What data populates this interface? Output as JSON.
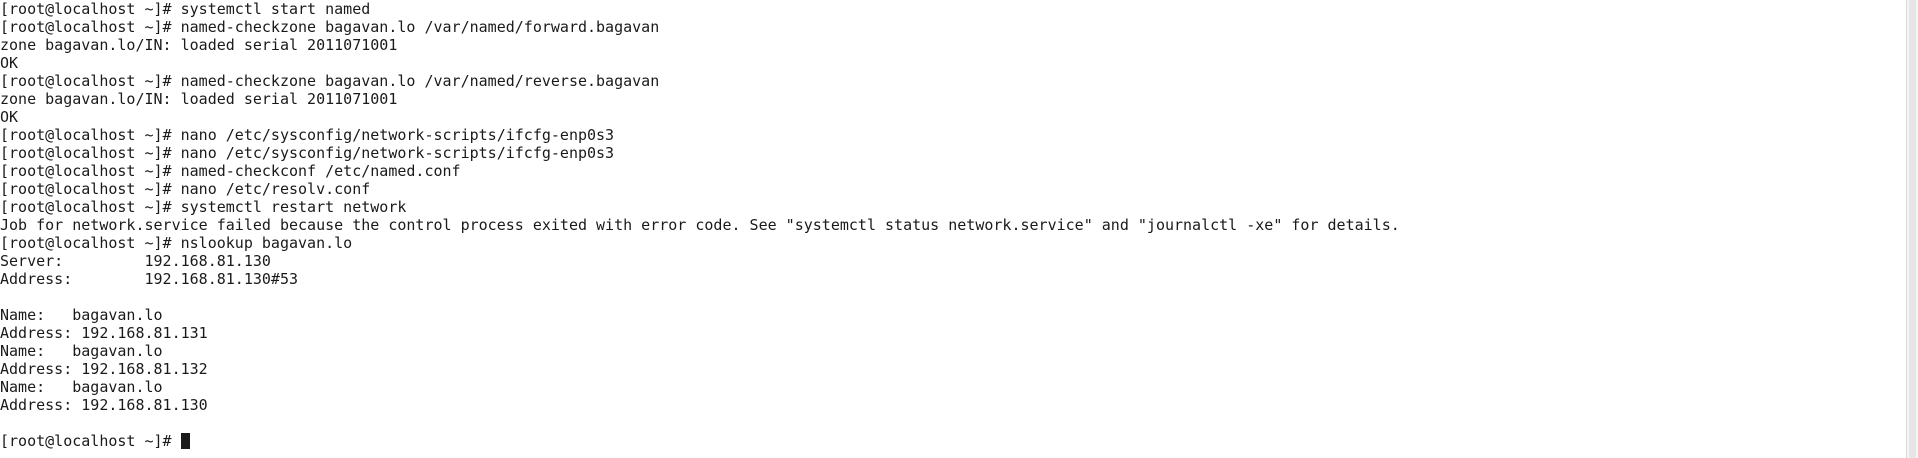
{
  "terminal": {
    "lines": [
      "[root@localhost ~]# systemctl start named",
      "[root@localhost ~]# named-checkzone bagavan.lo /var/named/forward.bagavan",
      "zone bagavan.lo/IN: loaded serial 2011071001",
      "OK",
      "[root@localhost ~]# named-checkzone bagavan.lo /var/named/reverse.bagavan",
      "zone bagavan.lo/IN: loaded serial 2011071001",
      "OK",
      "[root@localhost ~]# nano /etc/sysconfig/network-scripts/ifcfg-enp0s3",
      "[root@localhost ~]# nano /etc/sysconfig/network-scripts/ifcfg-enp0s3",
      "[root@localhost ~]# named-checkconf /etc/named.conf",
      "[root@localhost ~]# nano /etc/resolv.conf",
      "[root@localhost ~]# systemctl restart network",
      "Job for network.service failed because the control process exited with error code. See \"systemctl status network.service\" and \"journalctl -xe\" for details.",
      "[root@localhost ~]# nslookup bagavan.lo",
      "Server:\t\t192.168.81.130",
      "Address:\t192.168.81.130#53",
      "",
      "Name:\tbagavan.lo",
      "Address: 192.168.81.131",
      "Name:\tbagavan.lo",
      "Address: 192.168.81.132",
      "Name:\tbagavan.lo",
      "Address: 192.168.81.130",
      ""
    ],
    "prompt": "[root@localhost ~]# "
  }
}
